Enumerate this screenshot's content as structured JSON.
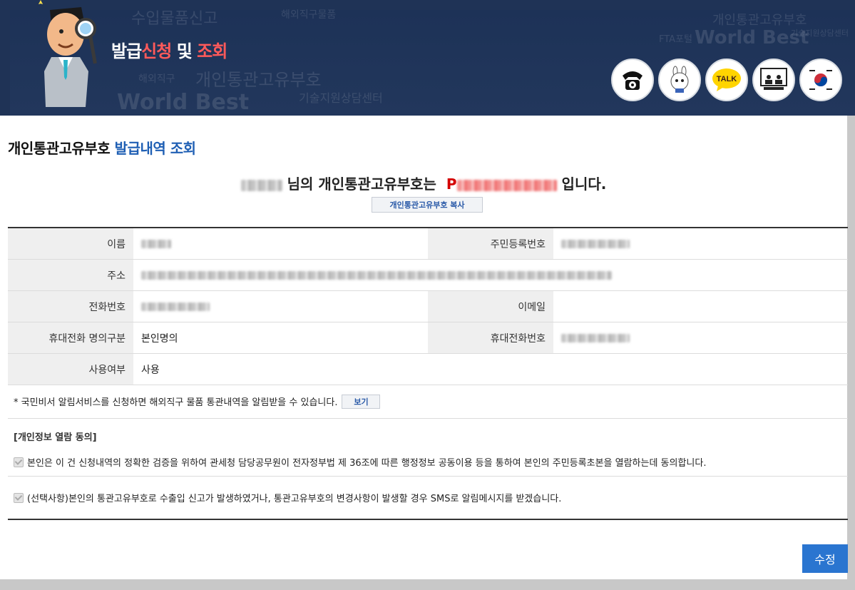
{
  "banner": {
    "title_part1": "발급",
    "title_part2": "신청",
    "title_part3": " 및 ",
    "title_part4": "조회",
    "icons": [
      "phone-icon",
      "chatbot-icon",
      "talk-icon",
      "video-consult-icon",
      "korea-gov-icon"
    ],
    "talk_label": "TALK"
  },
  "page": {
    "title_main": "개인통관고유부호 ",
    "title_accent": "발급내역 조회",
    "result_mid": "님의 개인통관고유부호는",
    "result_code_prefix": "P",
    "result_suffix": "입니다.",
    "copy_button": "개인통관고유부호 복사"
  },
  "table": {
    "name_label": "이름",
    "rrn_label": "주민등록번호",
    "address_label": "주소",
    "phone_label": "전화번호",
    "email_label": "이메일",
    "mobile_type_label": "휴대전화 명의구분",
    "mobile_type_value": "본인명의",
    "mobile_label": "휴대전화번호",
    "use_label": "사용여부",
    "use_value": "사용"
  },
  "notice": {
    "text": "* 국민비서 알림서비스를 신청하면 해외직구 물품 통관내역을 알림받을 수 있습니다.",
    "view_button": "보기"
  },
  "consent": {
    "title": "[개인정보 열람 동의]",
    "item1": "본인은 이 건 신청내역의 정확한 검증을 위하여 관세청 담당공무원이 전자정부법 제 36조에 따른 행정정보 공동이용 등을 통하여 본인의 주민등록초본을 열람하는데 동의합니다.",
    "item2": "(선택사항)본인의 통관고유부호로 수출입 신고가 발생하였거나, 통관고유부호의 변경사항이 발생할 경우 SMS로 알림메시지를 받겠습니다."
  },
  "actions": {
    "edit_button": "수정"
  }
}
